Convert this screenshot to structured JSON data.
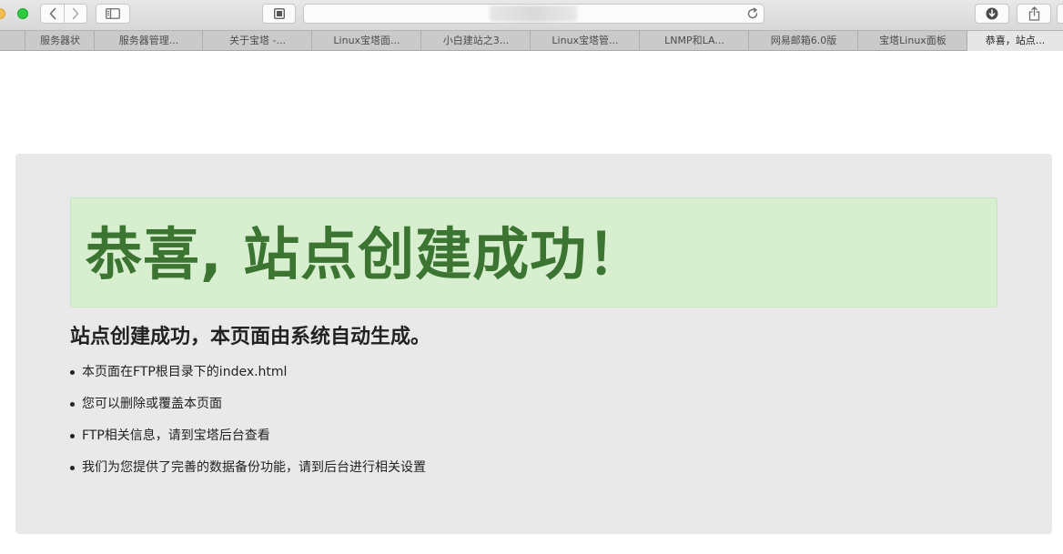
{
  "browser": {
    "tabs": [
      {
        "label": "服务器状"
      },
      {
        "label": "服务器管理..."
      },
      {
        "label": "关于宝塔 -..."
      },
      {
        "label": "Linux宝塔面..."
      },
      {
        "label": "小白建站之3..."
      },
      {
        "label": "Linux宝塔管..."
      },
      {
        "label": "LNMP和LA..."
      },
      {
        "label": "网易邮箱6.0版"
      },
      {
        "label": "宝塔Linux面板"
      },
      {
        "label": "恭喜，站点..."
      }
    ],
    "active_tab_index": 9
  },
  "page": {
    "alert_title": "恭喜, 站点创建成功！",
    "subtitle": "站点创建成功，本页面由系统自动生成。",
    "items": [
      "本页面在FTP根目录下的index.html",
      "您可以删除或覆盖本页面",
      "FTP相关信息，请到宝塔后台查看",
      "我们为您提供了完善的数据备份功能，请到后台进行相关设置"
    ]
  },
  "colors": {
    "alert_background": "#d7efcf",
    "alert_text": "#3c7431",
    "card_background": "#e9e9ea"
  },
  "icons": [
    "back-icon",
    "forward-icon",
    "sidebar-icon",
    "reader-icon",
    "reload-icon",
    "download-icon",
    "share-icon"
  ]
}
